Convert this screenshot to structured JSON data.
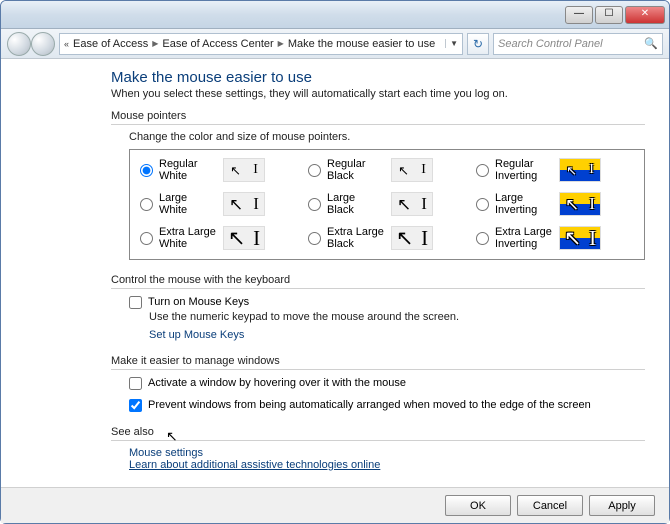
{
  "titlebar": {
    "minimize": "—",
    "maximize": "☐",
    "close": "✕"
  },
  "navbar": {
    "chevrons": "«",
    "crumb1": "Ease of Access",
    "crumb2": "Ease of Access Center",
    "crumb3": "Make the mouse easier to use",
    "sep": "▶",
    "dropdown": "▼",
    "refresh": "↻"
  },
  "search": {
    "placeholder": "Search Control Panel",
    "icon": "🔍"
  },
  "page": {
    "title": "Make the mouse easier to use",
    "subtitle": "When you select these settings, they will automatically start each time you log on."
  },
  "pointers": {
    "legend": "Mouse pointers",
    "hint": "Change the color and size of mouse pointers.",
    "opts": [
      "Regular White",
      "Regular Black",
      "Regular Inverting",
      "Large White",
      "Large Black",
      "Large Inverting",
      "Extra Large White",
      "Extra Large Black",
      "Extra Large Inverting"
    ],
    "selected": 0
  },
  "keyboard": {
    "legend": "Control the mouse with the keyboard",
    "mousekeys_label": "Turn on Mouse Keys",
    "mousekeys_checked": false,
    "mousekeys_desc": "Use the numeric keypad to move the mouse around the screen.",
    "setup_link": "Set up Mouse Keys"
  },
  "windows": {
    "legend": "Make it easier to manage windows",
    "activate_label": "Activate a window by hovering over it with the mouse",
    "activate_checked": false,
    "prevent_label": "Prevent windows from being automatically arranged when moved to the edge of the screen",
    "prevent_checked": true
  },
  "seealso": {
    "legend": "See also",
    "link1": "Mouse settings",
    "link2": "Learn about additional assistive technologies online"
  },
  "buttons": {
    "ok": "OK",
    "cancel": "Cancel",
    "apply": "Apply"
  }
}
